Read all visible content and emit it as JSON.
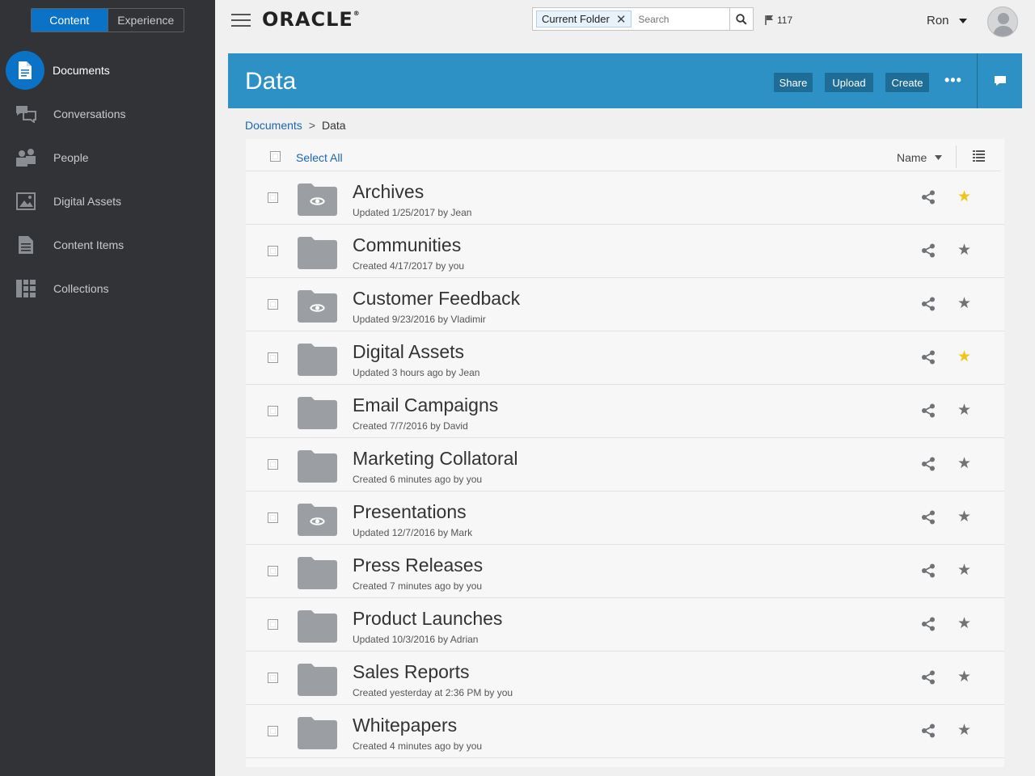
{
  "sidebar": {
    "mode_tabs": [
      {
        "label": "Content",
        "active": true
      },
      {
        "label": "Experience",
        "active": false
      }
    ],
    "items": [
      {
        "label": "Documents",
        "icon": "document-icon",
        "active": true
      },
      {
        "label": "Conversations",
        "icon": "conversations-icon",
        "active": false
      },
      {
        "label": "People",
        "icon": "people-icon",
        "active": false
      },
      {
        "label": "Digital Assets",
        "icon": "image-icon",
        "active": false
      },
      {
        "label": "Content Items",
        "icon": "content-item-icon",
        "active": false
      },
      {
        "label": "Collections",
        "icon": "collections-icon",
        "active": false
      }
    ]
  },
  "header": {
    "logo": "ORACLE",
    "search": {
      "scope_chip": "Current Folder",
      "placeholder": "Search"
    },
    "flag_count": "117",
    "user_name": "Ron"
  },
  "banner": {
    "title": "Data",
    "buttons": {
      "share": "Share",
      "upload": "Upload",
      "create": "Create"
    }
  },
  "breadcrumb": {
    "root": "Documents",
    "separator": ">",
    "current": "Data"
  },
  "list": {
    "select_all": "Select All",
    "sort_label": "Name",
    "folders": [
      {
        "name": "Archives",
        "meta": "Updated 1/25/2017 by Jean",
        "shared": true,
        "favorite": true
      },
      {
        "name": "Communities",
        "meta": "Created 4/17/2017 by you",
        "shared": false,
        "favorite": false
      },
      {
        "name": "Customer Feedback",
        "meta": "Updated 9/23/2016 by Vladimir",
        "shared": true,
        "favorite": false
      },
      {
        "name": "Digital Assets",
        "meta": "Updated 3 hours ago by Jean",
        "shared": false,
        "favorite": true
      },
      {
        "name": "Email Campaigns",
        "meta": "Created 7/7/2016 by David",
        "shared": false,
        "favorite": false
      },
      {
        "name": "Marketing Collatoral",
        "meta": "Created 6 minutes ago by you",
        "shared": false,
        "favorite": false
      },
      {
        "name": "Presentations",
        "meta": "Updated 12/7/2016 by Mark",
        "shared": true,
        "favorite": false
      },
      {
        "name": "Press Releases",
        "meta": "Created 7 minutes ago by you",
        "shared": false,
        "favorite": false
      },
      {
        "name": "Product Launches",
        "meta": "Updated 10/3/2016 by Adrian",
        "shared": false,
        "favorite": false
      },
      {
        "name": "Sales Reports",
        "meta": "Created yesterday at 2:36 PM by you",
        "shared": false,
        "favorite": false
      },
      {
        "name": "Whitepapers",
        "meta": "Created 4 minutes ago by you",
        "shared": false,
        "favorite": false
      }
    ]
  },
  "colors": {
    "sidebar_bg": "#313336",
    "accent": "#0a73c8",
    "banner": "#2d91c6",
    "favorite": "#f0c41b"
  }
}
